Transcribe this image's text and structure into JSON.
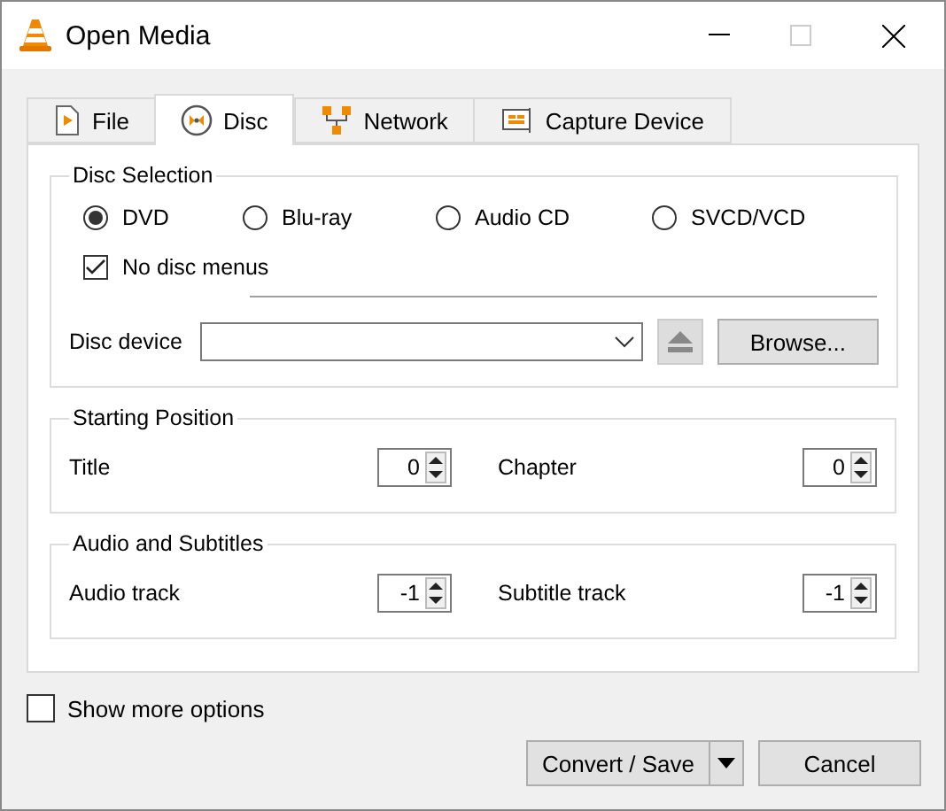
{
  "window": {
    "title": "Open Media"
  },
  "tabs": [
    {
      "label": "File",
      "kind": "file",
      "selected": false
    },
    {
      "label": "Disc",
      "kind": "disc",
      "selected": true
    },
    {
      "label": "Network",
      "kind": "network",
      "selected": false
    },
    {
      "label": "Capture Device",
      "kind": "capture",
      "selected": false
    }
  ],
  "disc_selection": {
    "title": "Disc Selection",
    "disc_types": [
      {
        "label": "DVD",
        "selected": true
      },
      {
        "label": "Blu-ray",
        "selected": false
      },
      {
        "label": "Audio CD",
        "selected": false
      },
      {
        "label": "SVCD/VCD",
        "selected": false
      }
    ],
    "no_disc_menus": {
      "label": "No disc menus",
      "checked": true
    },
    "disc_device": {
      "label": "Disc device",
      "browse": "Browse..."
    }
  },
  "starting_position": {
    "title": "Starting Position",
    "fields": [
      {
        "label": "Title",
        "value": "0"
      },
      {
        "label": "Chapter",
        "value": "0"
      }
    ]
  },
  "audio_and_subtitles": {
    "title": "Audio and Subtitles",
    "fields": [
      {
        "label": "Audio track",
        "value": "-1"
      },
      {
        "label": "Subtitle track",
        "value": "-1"
      }
    ]
  },
  "show_more_options": {
    "label": "Show more options",
    "checked": false
  },
  "buttons": {
    "convert": "Convert / Save",
    "cancel": "Cancel"
  }
}
